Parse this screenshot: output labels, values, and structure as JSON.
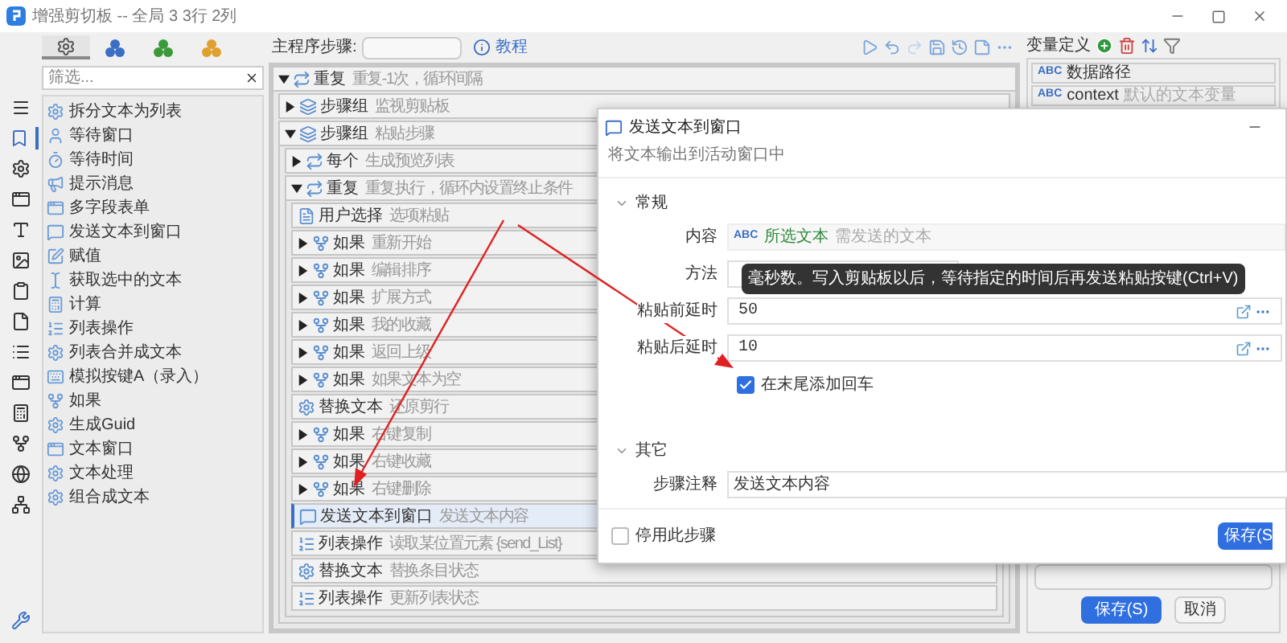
{
  "window": {
    "title": "增强剪切板 -- 全局 3 3行 2列"
  },
  "rail": [
    {
      "kind": "menu",
      "selected": false
    },
    {
      "kind": "bookmark",
      "selected": true
    },
    {
      "kind": "gear",
      "selected": false
    },
    {
      "kind": "window",
      "selected": false
    },
    {
      "kind": "text",
      "selected": false
    },
    {
      "kind": "image",
      "selected": false
    },
    {
      "kind": "clipboard",
      "selected": false
    },
    {
      "kind": "file",
      "selected": false
    },
    {
      "kind": "list",
      "selected": false
    },
    {
      "kind": "windows",
      "selected": false
    },
    {
      "kind": "calc",
      "selected": false
    },
    {
      "kind": "branch",
      "selected": false
    },
    {
      "kind": "globe",
      "selected": false
    },
    {
      "kind": "network",
      "selected": false
    }
  ],
  "palette_tabs": [
    {
      "kind": "gears",
      "color": "#555555",
      "selected": true
    },
    {
      "kind": "cluster",
      "color": "#3b6fc4",
      "selected": false
    },
    {
      "kind": "cluster",
      "color": "#3a9a3a",
      "selected": false
    },
    {
      "kind": "cluster",
      "color": "#e0a030",
      "selected": false
    }
  ],
  "filter": {
    "placeholder": "筛选..."
  },
  "actions": [
    {
      "kind": "gear",
      "label": "拆分文本为列表"
    },
    {
      "kind": "user",
      "label": "等待窗口"
    },
    {
      "kind": "timer",
      "label": "等待时间"
    },
    {
      "kind": "megaphone",
      "label": "提示消息"
    },
    {
      "kind": "window",
      "label": "多字段表单"
    },
    {
      "kind": "message",
      "label": "发送文本到窗口"
    },
    {
      "kind": "edit",
      "label": "赋值"
    },
    {
      "kind": "cursor",
      "label": "获取选中的文本"
    },
    {
      "kind": "calc",
      "label": "计算"
    },
    {
      "kind": "list",
      "label": "列表操作"
    },
    {
      "kind": "gear",
      "label": "列表合并成文本"
    },
    {
      "kind": "keyboard",
      "label": "模拟按键A（录入）"
    },
    {
      "kind": "branch",
      "label": "如果"
    },
    {
      "kind": "gear",
      "label": "生成Guid"
    },
    {
      "kind": "window",
      "label": "文本窗口"
    },
    {
      "kind": "gear",
      "label": "文本处理"
    },
    {
      "kind": "gear",
      "label": "组合成文本"
    }
  ],
  "toolbar": {
    "label": "主程序步骤:",
    "tutorial": "教程"
  },
  "tree": [
    {
      "kind": "repeat",
      "title": "重复",
      "desc": "重复-1次，循环间隔",
      "expanded": true,
      "selected": false,
      "children": [
        {
          "kind": "group",
          "title": "步骤组",
          "desc": "监视剪贴板",
          "expanded": false,
          "selected": false
        },
        {
          "kind": "group",
          "title": "步骤组",
          "desc": "粘贴步骤",
          "expanded": true,
          "selected": false,
          "children": [
            {
              "kind": "repeat",
              "title": "每个",
              "desc": "生成预览列表",
              "expanded": false,
              "selected": false
            },
            {
              "kind": "repeat",
              "title": "重复",
              "desc": "重复执行，循环内设置终止条件",
              "expanded": true,
              "selected": false,
              "children": [
                {
                  "kind": "select",
                  "title": "用户选择",
                  "desc": "选项粘贴",
                  "selected": false
                },
                {
                  "kind": "if",
                  "title": "如果",
                  "desc": "重新开始",
                  "expanded": false,
                  "selected": false
                },
                {
                  "kind": "if",
                  "title": "如果",
                  "desc": "编辑排序",
                  "expanded": false,
                  "selected": false
                },
                {
                  "kind": "if",
                  "title": "如果",
                  "desc": "扩展方式",
                  "expanded": false,
                  "selected": false
                },
                {
                  "kind": "if",
                  "title": "如果",
                  "desc": "我的收藏",
                  "expanded": false,
                  "selected": false
                },
                {
                  "kind": "if",
                  "title": "如果",
                  "desc": "返回上级",
                  "expanded": false,
                  "selected": false
                },
                {
                  "kind": "if",
                  "title": "如果",
                  "desc": "如果文本为空",
                  "expanded": false,
                  "selected": false
                },
                {
                  "kind": "replace",
                  "title": "替换文本",
                  "desc": "还原剪行",
                  "selected": false
                },
                {
                  "kind": "if",
                  "title": "如果",
                  "desc": "右键复制",
                  "expanded": false,
                  "selected": false
                },
                {
                  "kind": "if",
                  "title": "如果",
                  "desc": "右键收藏",
                  "expanded": false,
                  "selected": false
                },
                {
                  "kind": "if",
                  "title": "如果",
                  "desc": "右键删除",
                  "expanded": false,
                  "selected": false
                },
                {
                  "kind": "send",
                  "title": "发送文本到窗口",
                  "desc": "发送文本内容",
                  "selected": true
                },
                {
                  "kind": "list",
                  "title": "列表操作",
                  "desc": "读取某位置元素 {send_List}",
                  "selected": false
                },
                {
                  "kind": "replace",
                  "title": "替换文本",
                  "desc": "替换条目状态",
                  "selected": false
                },
                {
                  "kind": "list",
                  "title": "列表操作",
                  "desc": "更新列表状态",
                  "selected": false
                }
              ]
            }
          ]
        }
      ]
    }
  ],
  "variables": {
    "title": "变量定义",
    "items": [
      {
        "badge": "ABC",
        "name": "数据路径"
      },
      {
        "badge": "ABC",
        "name": "context",
        "desc": "默认的文本变量"
      }
    ],
    "save": "保存(S)",
    "cancel": "取消"
  },
  "dialog": {
    "title": "发送文本到窗口",
    "subtitle": "将文本输出到活动窗口中",
    "sections": [
      {
        "title": "常规",
        "expanded": true,
        "fields": [
          {
            "kind": "variable",
            "label": "内容",
            "badge": "ABC",
            "value": "所选文本",
            "desc": "需发送的文本"
          },
          {
            "kind": "select",
            "label": "方法"
          },
          {
            "kind": "number",
            "label": "粘贴前延时",
            "value": "50"
          },
          {
            "kind": "number",
            "label": "粘贴后延时",
            "value": "10"
          },
          {
            "kind": "checkbox",
            "label": "在末尾添加回车",
            "checked": true
          }
        ]
      },
      {
        "title": "其它",
        "expanded": true,
        "fields": [
          {
            "kind": "text",
            "label": "步骤注释",
            "value": "发送文本内容"
          }
        ]
      }
    ],
    "tooltip": "毫秒数。写入剪贴板以后，等待指定的时间后再发送粘贴按键(Ctrl+V)",
    "footer": {
      "disable_label": "停用此步骤",
      "disable_checked": false,
      "save": "保存(S"
    }
  }
}
